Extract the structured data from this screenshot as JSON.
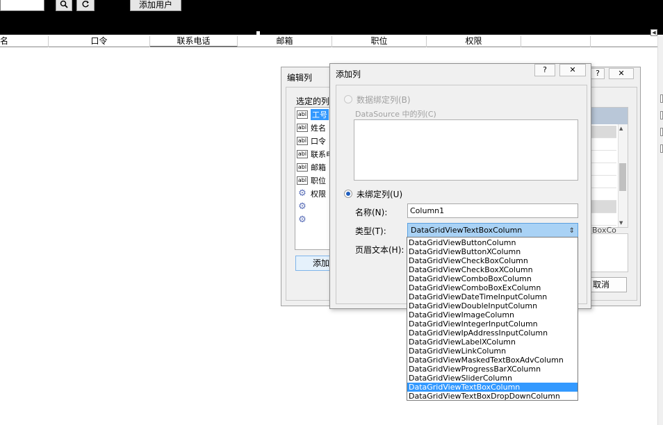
{
  "toolbar": {
    "search_icon": "search-icon",
    "refresh_icon": "refresh-icon",
    "add_user_label": "添加用户"
  },
  "grid": {
    "headers": [
      "名",
      "口令",
      "联系电话",
      "邮箱",
      "职位",
      "权限"
    ]
  },
  "edit_dialog": {
    "title": "编辑列",
    "help": "?",
    "close": "✕",
    "selected_columns_label": "选定的列",
    "columns": [
      {
        "icon": "abl",
        "label": "工号"
      },
      {
        "icon": "abl",
        "label": "姓名"
      },
      {
        "icon": "abl",
        "label": "口令"
      },
      {
        "icon": "abl",
        "label": "联系电"
      },
      {
        "icon": "abl",
        "label": "邮箱"
      },
      {
        "icon": "abl",
        "label": "职位"
      },
      {
        "icon": "gear",
        "label": "权限"
      },
      {
        "icon": "gear",
        "label": ""
      },
      {
        "icon": "gear",
        "label": ""
      }
    ],
    "add_button": "添加",
    "partial_text": "BoxCo",
    "cancel_button": "取消"
  },
  "add_dialog": {
    "title": "添加列",
    "help": "?",
    "close": "✕",
    "databound_radio": "数据绑定列(B)",
    "datasource_label": "DataSource 中的列(C)",
    "unbound_radio": "未绑定列(U)",
    "name_label": "名称(N):",
    "name_value": "Column1",
    "type_label": "类型(T):",
    "type_value": "DataGridViewTextBoxColumn",
    "header_text_label": "页眉文本(H):"
  },
  "dropdown": {
    "options": [
      "DataGridViewButtonColumn",
      "DataGridViewButtonXColumn",
      "DataGridViewCheckBoxColumn",
      "DataGridViewCheckBoxXColumn",
      "DataGridViewComboBoxColumn",
      "DataGridViewComboBoxExColumn",
      "DataGridViewDateTimeInputColumn",
      "DataGridViewDoubleInputColumn",
      "DataGridViewImageColumn",
      "DataGridViewIntegerInputColumn",
      "DataGridViewIpAddressInputColumn",
      "DataGridViewLabelXColumn",
      "DataGridViewLinkColumn",
      "DataGridViewMaskedTextBoxAdvColumn",
      "DataGridViewProgressBarXColumn",
      "DataGridViewSliderColumn",
      "DataGridViewTextBoxColumn",
      "DataGridViewTextBoxDropDownColumn"
    ],
    "selected_index": 16
  },
  "colors": {
    "selection": "#3399ff",
    "select_highlight": "#a9d2f5",
    "toolbar_bg": "#000000"
  }
}
